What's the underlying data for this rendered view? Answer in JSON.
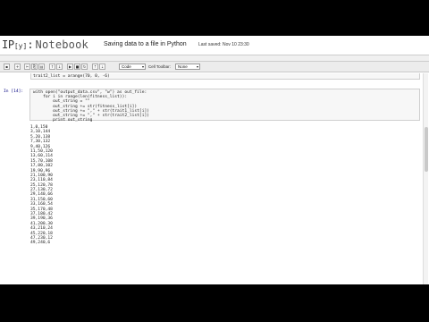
{
  "header": {
    "logo_ip": "IP",
    "logo_y": "[y]",
    "logo_colon": ":",
    "logo_notebook": "Notebook",
    "title": "Saving data to a file in Python",
    "last_saved": "Last saved: Nov 10 23:30"
  },
  "toolbar": {
    "cell_type": "Code",
    "cell_toolbar_label": "Cell Toolbar:",
    "cell_toolbar_value": "None"
  },
  "prev_cell": {
    "code": "trait2_list = arange(70, 0, -6)"
  },
  "cell": {
    "prompt": "In [14]:",
    "code": "with open(\"output_data.csv\", \"w\") as out_file:\n    for i in range(len(fitness_list)):\n        out_string = \"\"\n        out_string += str(fitness_list[i])\n        out_string += \",\" + str(trait1_list[i])\n        out_string += \",\" + str(trait2_list[i])\n        print out_string"
  },
  "output": [
    "1,0,150",
    "3,10,144",
    "5,20,138",
    "7,30,132",
    "9,40,126",
    "11,50,120",
    "13,60,114",
    "15,70,108",
    "17,80,102",
    "19,90,96",
    "21,100,90",
    "23,110,84",
    "25,120,78",
    "27,130,72",
    "29,140,66",
    "31,150,60",
    "33,160,54",
    "35,170,48",
    "37,180,42",
    "39,190,36",
    "41,200,30",
    "43,210,24",
    "45,220,18",
    "47,230,12",
    "49,240,6"
  ]
}
